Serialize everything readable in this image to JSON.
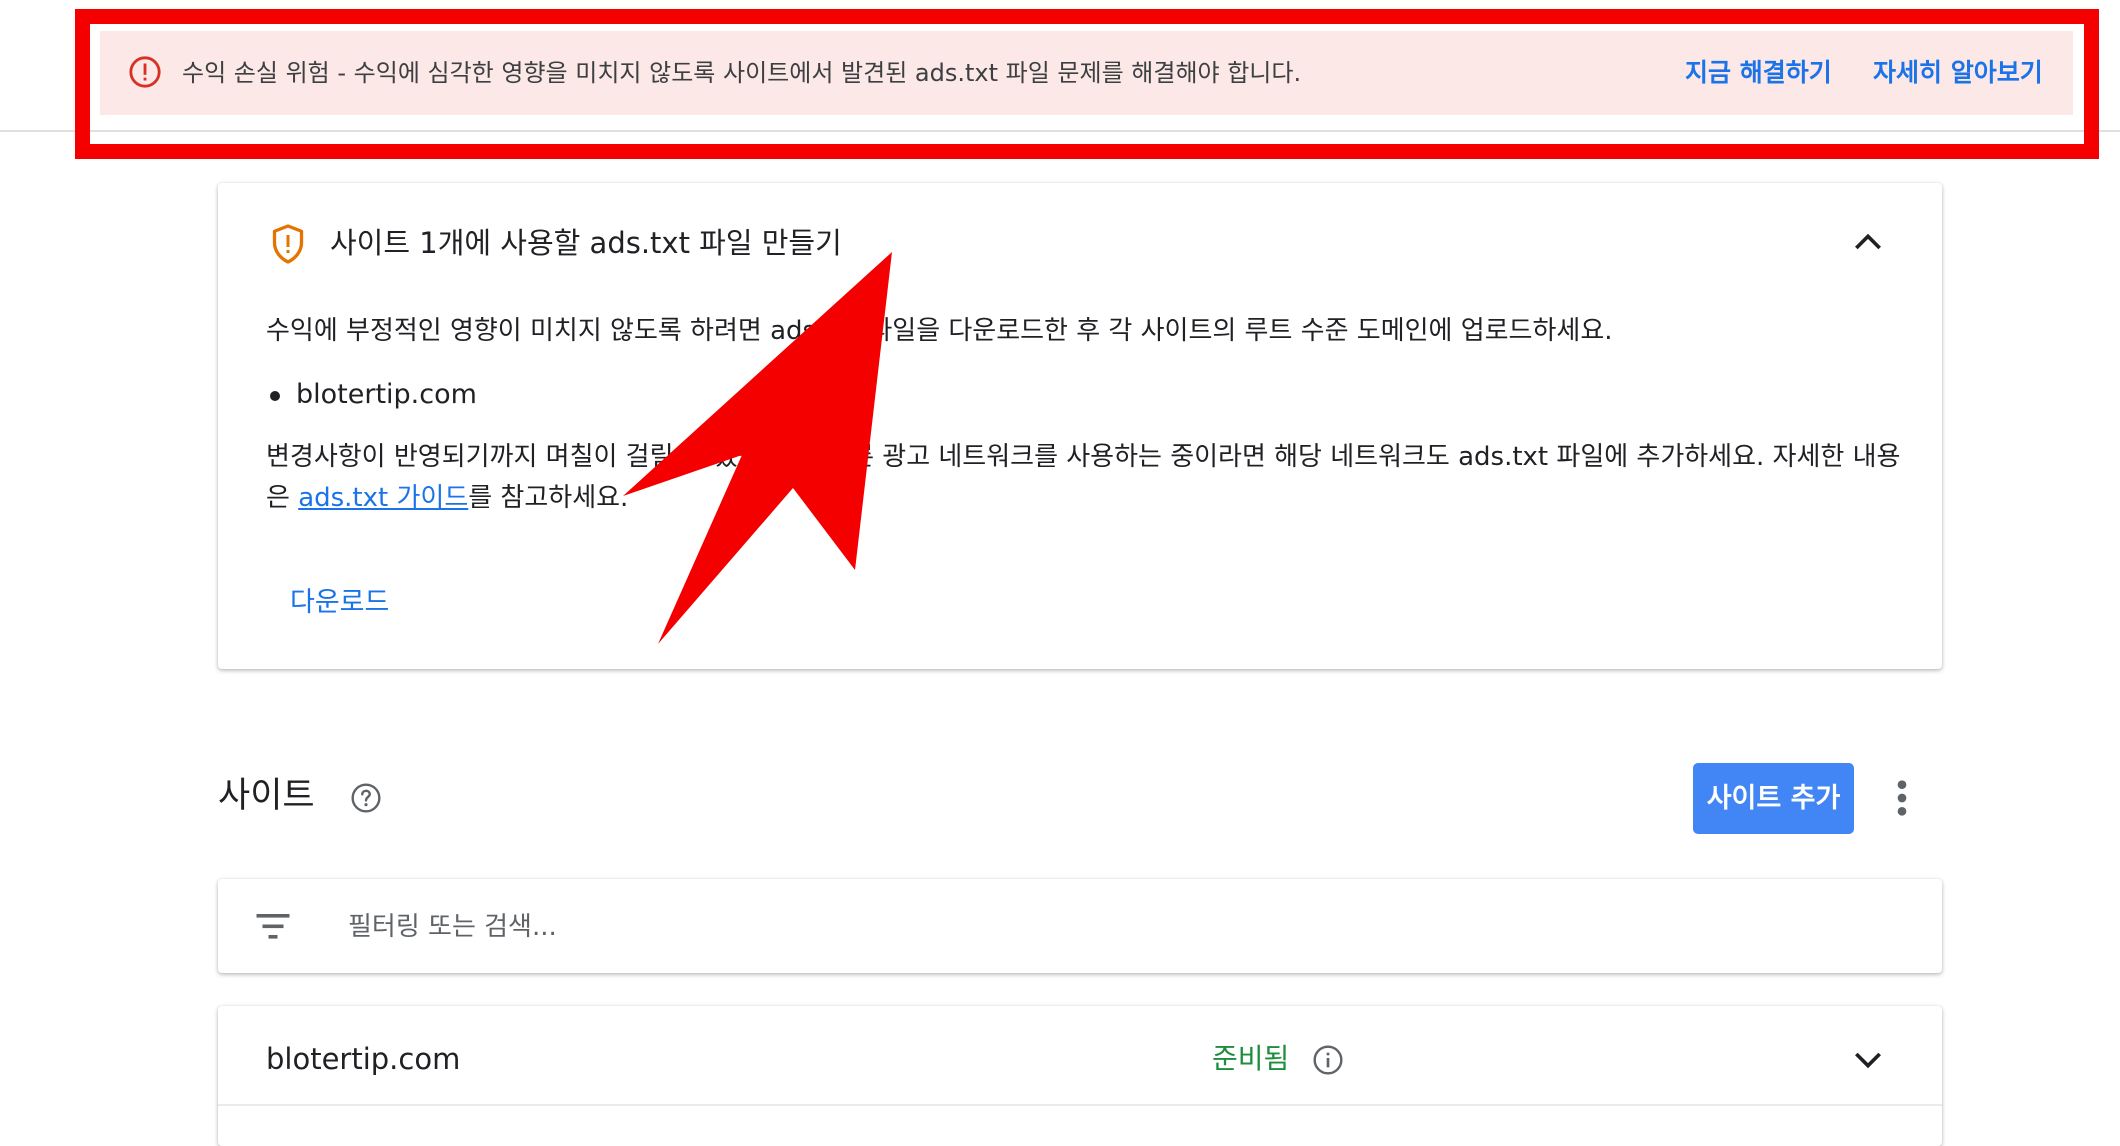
{
  "banner": {
    "message": "수익 손실 위험 - 수익에 심각한 영향을 미치지 않도록 사이트에서 발견된 ads.txt 파일 문제를 해결해야 합니다.",
    "fix_now": "지금 해결하기",
    "learn_more": "자세히 알아보기",
    "icon": "error-icon"
  },
  "ads_card": {
    "title": "사이트 1개에 사용할 ads.txt 파일 만들기",
    "intro": "수익에 부정적인 영향이 미치지 않도록 하려면 ads.txt 파일을 다운로드한 후 각 사이트의 루트 수준 도메인에 업로드하세요.",
    "sites": [
      "blotertip.com"
    ],
    "note_before": "변경사항이 반영되기까지 며칠이 걸릴 수 있습니다. 다른 광고 네트워크를 사용하는 중이라면 해당 네트워크도 ads.txt 파일에 추가하세요. 자세한 내용은 ",
    "guide_link": "ads.txt 가이드",
    "note_after": "를 참고하세요.",
    "download": "다운로드",
    "icons": {
      "shield": "shield-warning-icon",
      "collapse": "chevron-up-icon"
    }
  },
  "sites_section": {
    "title": "사이트",
    "add_button": "사이트 추가",
    "filter_placeholder": "필터링 또는 검색...",
    "icons": {
      "help": "help-icon",
      "more": "more-vert-icon",
      "filter": "filter-icon"
    }
  },
  "site_rows": [
    {
      "domain": "blotertip.com",
      "status": "준비됨"
    }
  ],
  "colors": {
    "accent": "#1a73e8",
    "button": "#4285f4",
    "banner_bg": "#fce8e6",
    "error": "#d93025",
    "warning": "#e37400",
    "ready": "#1e8e3e",
    "annotation": "#f40000"
  }
}
